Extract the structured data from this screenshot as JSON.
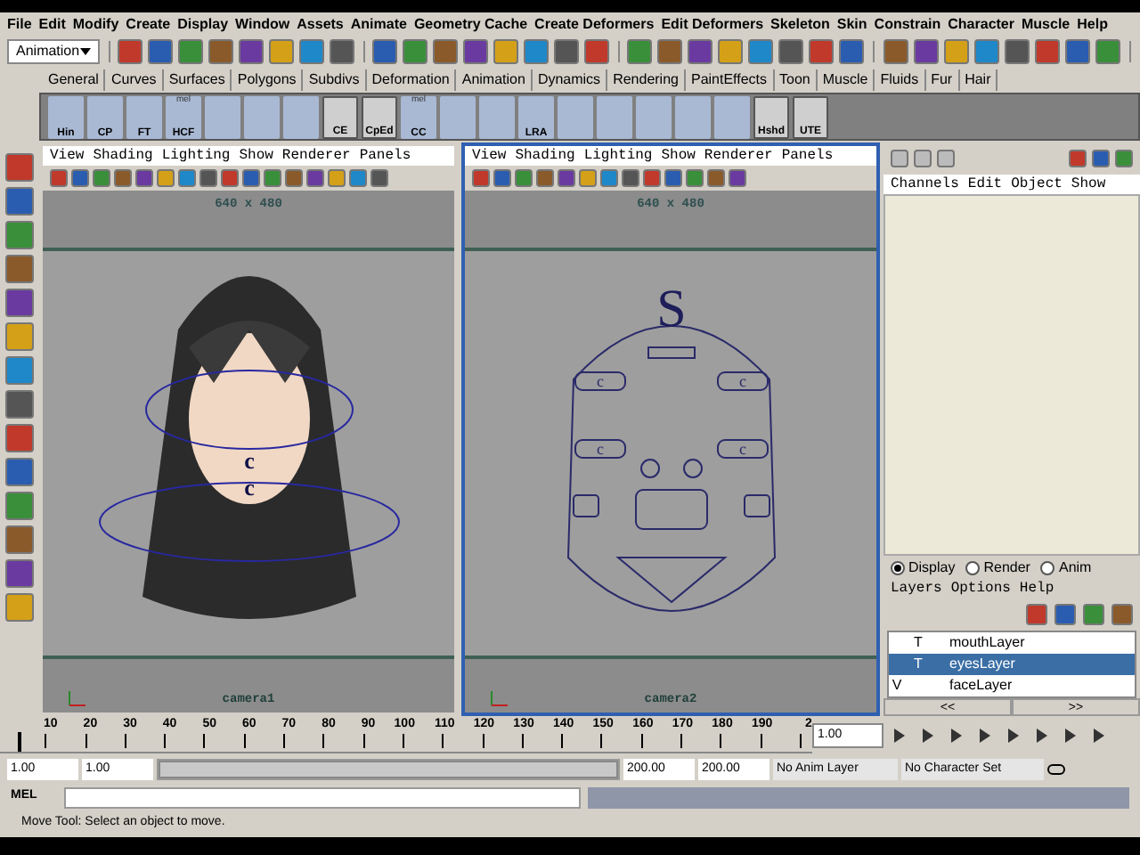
{
  "menu_bar": [
    "File",
    "Edit",
    "Modify",
    "Create",
    "Display",
    "Window",
    "Assets",
    "Animate",
    "Geometry Cache",
    "Create Deformers",
    "Edit Deformers",
    "Skeleton",
    "Skin",
    "Constrain",
    "Character",
    "Muscle",
    "Help"
  ],
  "mode_dropdown": {
    "value": "Animation"
  },
  "shelf_tabs": [
    "General",
    "Curves",
    "Surfaces",
    "Polygons",
    "Subdivs",
    "Deformation",
    "Animation",
    "Dynamics",
    "Rendering",
    "PaintEffects",
    "Toon",
    "Muscle",
    "Fluids",
    "Fur",
    "Hair"
  ],
  "shelf_buttons": [
    {
      "label": "Hin",
      "kind": "icon"
    },
    {
      "label": "CP",
      "kind": "icon"
    },
    {
      "label": "FT",
      "kind": "icon"
    },
    {
      "label": "HCF",
      "badge": "mel",
      "kind": "icon"
    },
    {
      "kind": "icon"
    },
    {
      "kind": "icon"
    },
    {
      "kind": "icon"
    },
    {
      "label": "CE",
      "kind": "blank"
    },
    {
      "label": "CpEd",
      "kind": "blank"
    },
    {
      "label": "CC",
      "badge": "mel",
      "kind": "icon"
    },
    {
      "kind": "icon"
    },
    {
      "kind": "icon"
    },
    {
      "label": "LRA",
      "kind": "icon"
    },
    {
      "kind": "icon"
    },
    {
      "kind": "icon"
    },
    {
      "kind": "icon"
    },
    {
      "kind": "icon"
    },
    {
      "kind": "icon"
    },
    {
      "label": "Hshd",
      "kind": "blank"
    },
    {
      "label": "UTE",
      "kind": "blank"
    }
  ],
  "viewports": [
    {
      "menus": [
        "View",
        "Shading",
        "Lighting",
        "Show",
        "Renderer",
        "Panels"
      ],
      "resolution": "640 x 480",
      "camera": "camera1",
      "selected": false,
      "kind": "character",
      "control_labels": [
        "c",
        "c"
      ]
    },
    {
      "menus": [
        "View",
        "Shading",
        "Lighting",
        "Show",
        "Renderer",
        "Panels"
      ],
      "resolution": "640 x 480",
      "camera": "camera2",
      "selected": true,
      "kind": "rig",
      "control_labels": [
        "S",
        "c",
        "c",
        "c",
        "c"
      ]
    }
  ],
  "channel_box": {
    "menus": [
      "Channels",
      "Edit",
      "Object",
      "Show"
    ]
  },
  "layer_editor": {
    "modes": [
      {
        "label": "Display",
        "selected": true
      },
      {
        "label": "Render",
        "selected": false
      },
      {
        "label": "Anim",
        "selected": false
      }
    ],
    "menus": [
      "Layers",
      "Options",
      "Help"
    ],
    "layers": [
      {
        "name": "mouthLayer",
        "display_type": "T",
        "selected": false
      },
      {
        "name": "eyesLayer",
        "display_type": "T",
        "selected": true
      },
      {
        "name": "faceLayer",
        "visibility": "V",
        "selected": false
      }
    ],
    "page_buttons": [
      "<<",
      ">>"
    ]
  },
  "timeline": {
    "ticks": [
      "10",
      "20",
      "30",
      "40",
      "50",
      "60",
      "70",
      "80",
      "90",
      "100",
      "110",
      "120",
      "130",
      "140",
      "150",
      "160",
      "170",
      "180",
      "190",
      "2"
    ],
    "current_time": "1.00",
    "level": 0
  },
  "range": {
    "level": 1,
    "start": "1.00",
    "playback_start": "1.00",
    "playback_end": "200.00",
    "end": "200.00",
    "anim_layer": "No Anim Layer",
    "character_set": "No Character Set"
  },
  "command_line": {
    "label": "MEL"
  },
  "help_line": "Move Tool: Select an object to move."
}
